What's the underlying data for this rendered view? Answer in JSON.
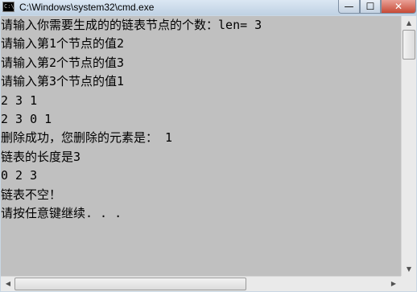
{
  "window": {
    "title": "C:\\Windows\\system32\\cmd.exe",
    "icon_text": "C:\\",
    "minimize_glyph": "—",
    "maximize_glyph": "☐",
    "close_glyph": "✕"
  },
  "console": {
    "lines": [
      "请输入你需要生成的的链表节点的个数：len= 3",
      "请输入第1个节点的值2",
      "请输入第2个节点的值3",
      "请输入第3个节点的值1",
      "2 3 1",
      "2 3 0 1",
      "删除成功，您删除的元素是： 1",
      "链表的长度是3",
      "0 2 3",
      "链表不空！",
      "请按任意键继续. . ."
    ]
  },
  "scrollbars": {
    "up_arrow": "▲",
    "down_arrow": "▼",
    "left_arrow": "◀",
    "right_arrow": "▶"
  },
  "colors": {
    "console_background": "#c0c0c0",
    "console_text": "#000000",
    "close_button": "#c74a36"
  }
}
